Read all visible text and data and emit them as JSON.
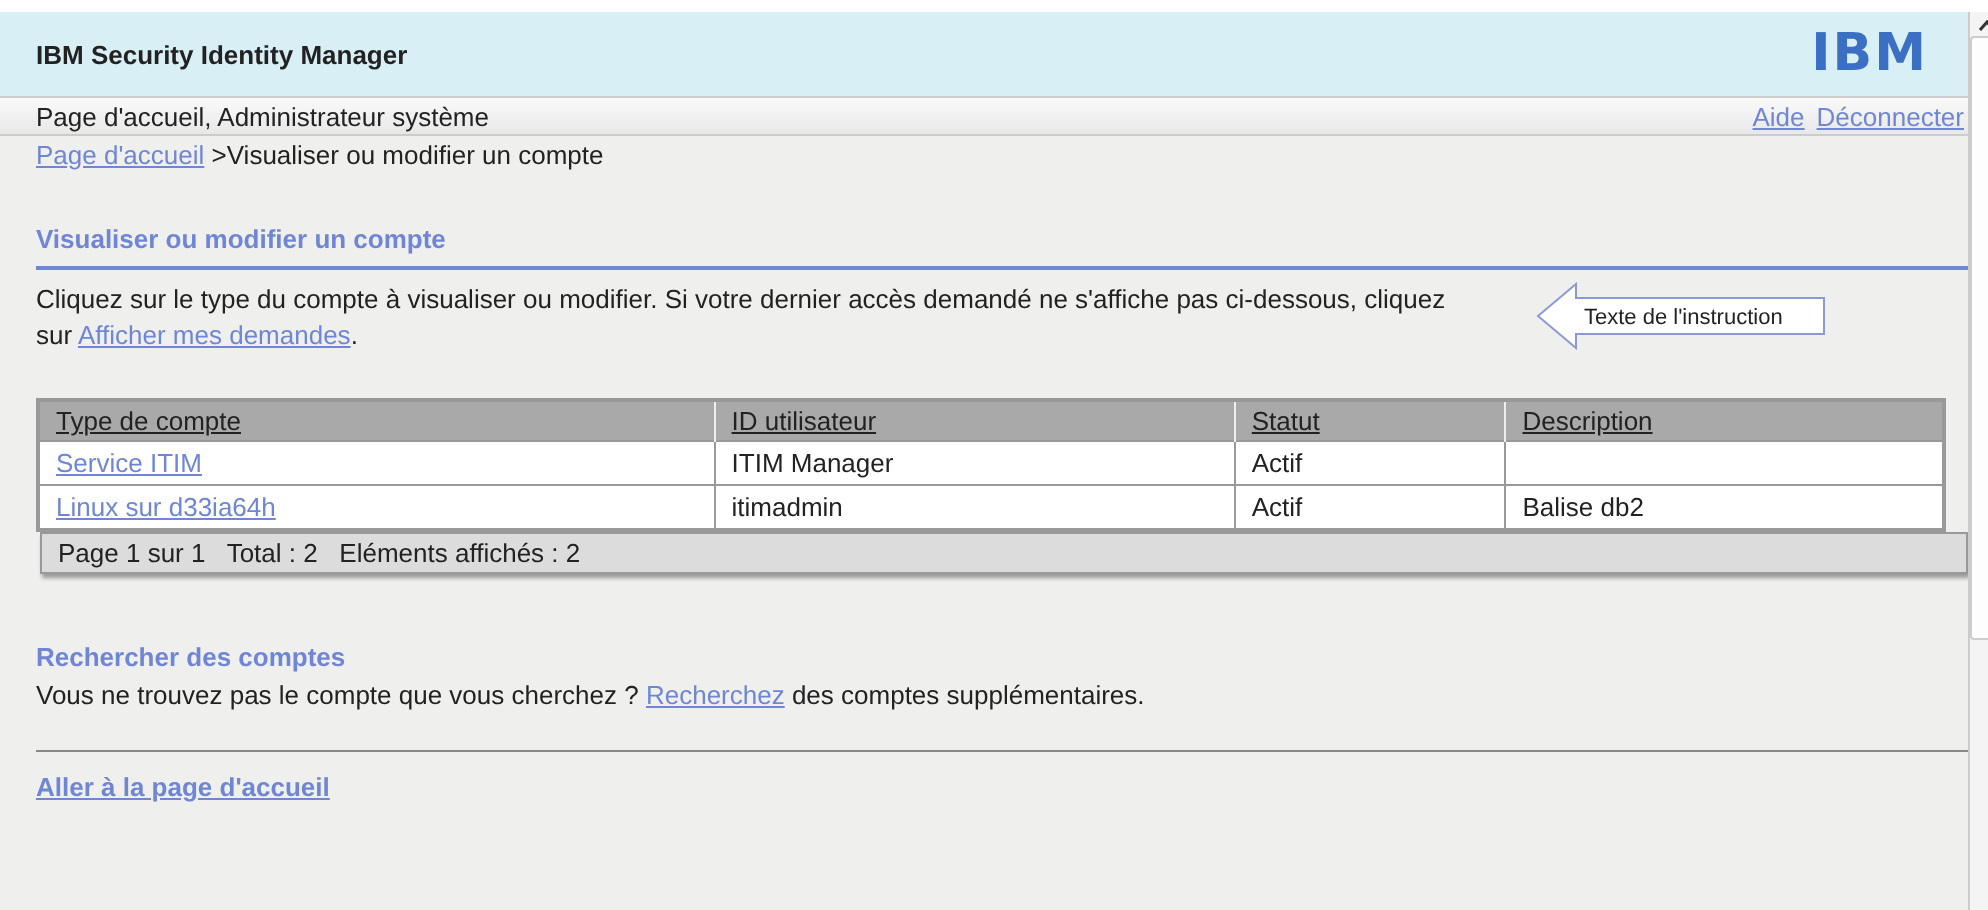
{
  "header": {
    "title": "IBM Security Identity Manager",
    "logo": "IBM"
  },
  "user_bar": {
    "text": "Page d'accueil, Administrateur système",
    "links": [
      "Aide",
      "Déconnecter"
    ]
  },
  "breadcrumb": {
    "link": "Page d'accueil",
    "current": ">Visualiser ou modifier un compte"
  },
  "section": {
    "title": "Visualiser ou modifier un compte",
    "instruction_before": "Cliquez sur le type du compte à visualiser ou modifier. Si votre dernier accès demandé ne s'affiche pas ci-dessous, cliquez sur ",
    "instruction_link": "Afficher mes demandes",
    "instruction_after": ".",
    "callout": "Texte de l'instruction"
  },
  "table": {
    "columns": [
      "Type de compte",
      "ID utilisateur",
      "Statut",
      "Description"
    ],
    "rows": [
      {
        "account_type": "Service ITIM",
        "user_id": "ITIM Manager",
        "status": "Actif",
        "description": ""
      },
      {
        "account_type": "Linux sur d33ia64h",
        "user_id": "itimadmin",
        "status": "Actif",
        "description": "Balise db2"
      }
    ],
    "pager": "Page 1 sur 1   Total : 2   Eléments affichés : 2"
  },
  "search": {
    "title": "Rechercher des comptes",
    "text_before": "Vous ne trouvez pas le compte que vous cherchez ? ",
    "link": "Recherchez",
    "text_after": " des comptes supplémentaires."
  },
  "home_link": "Aller à la page d'accueil"
}
